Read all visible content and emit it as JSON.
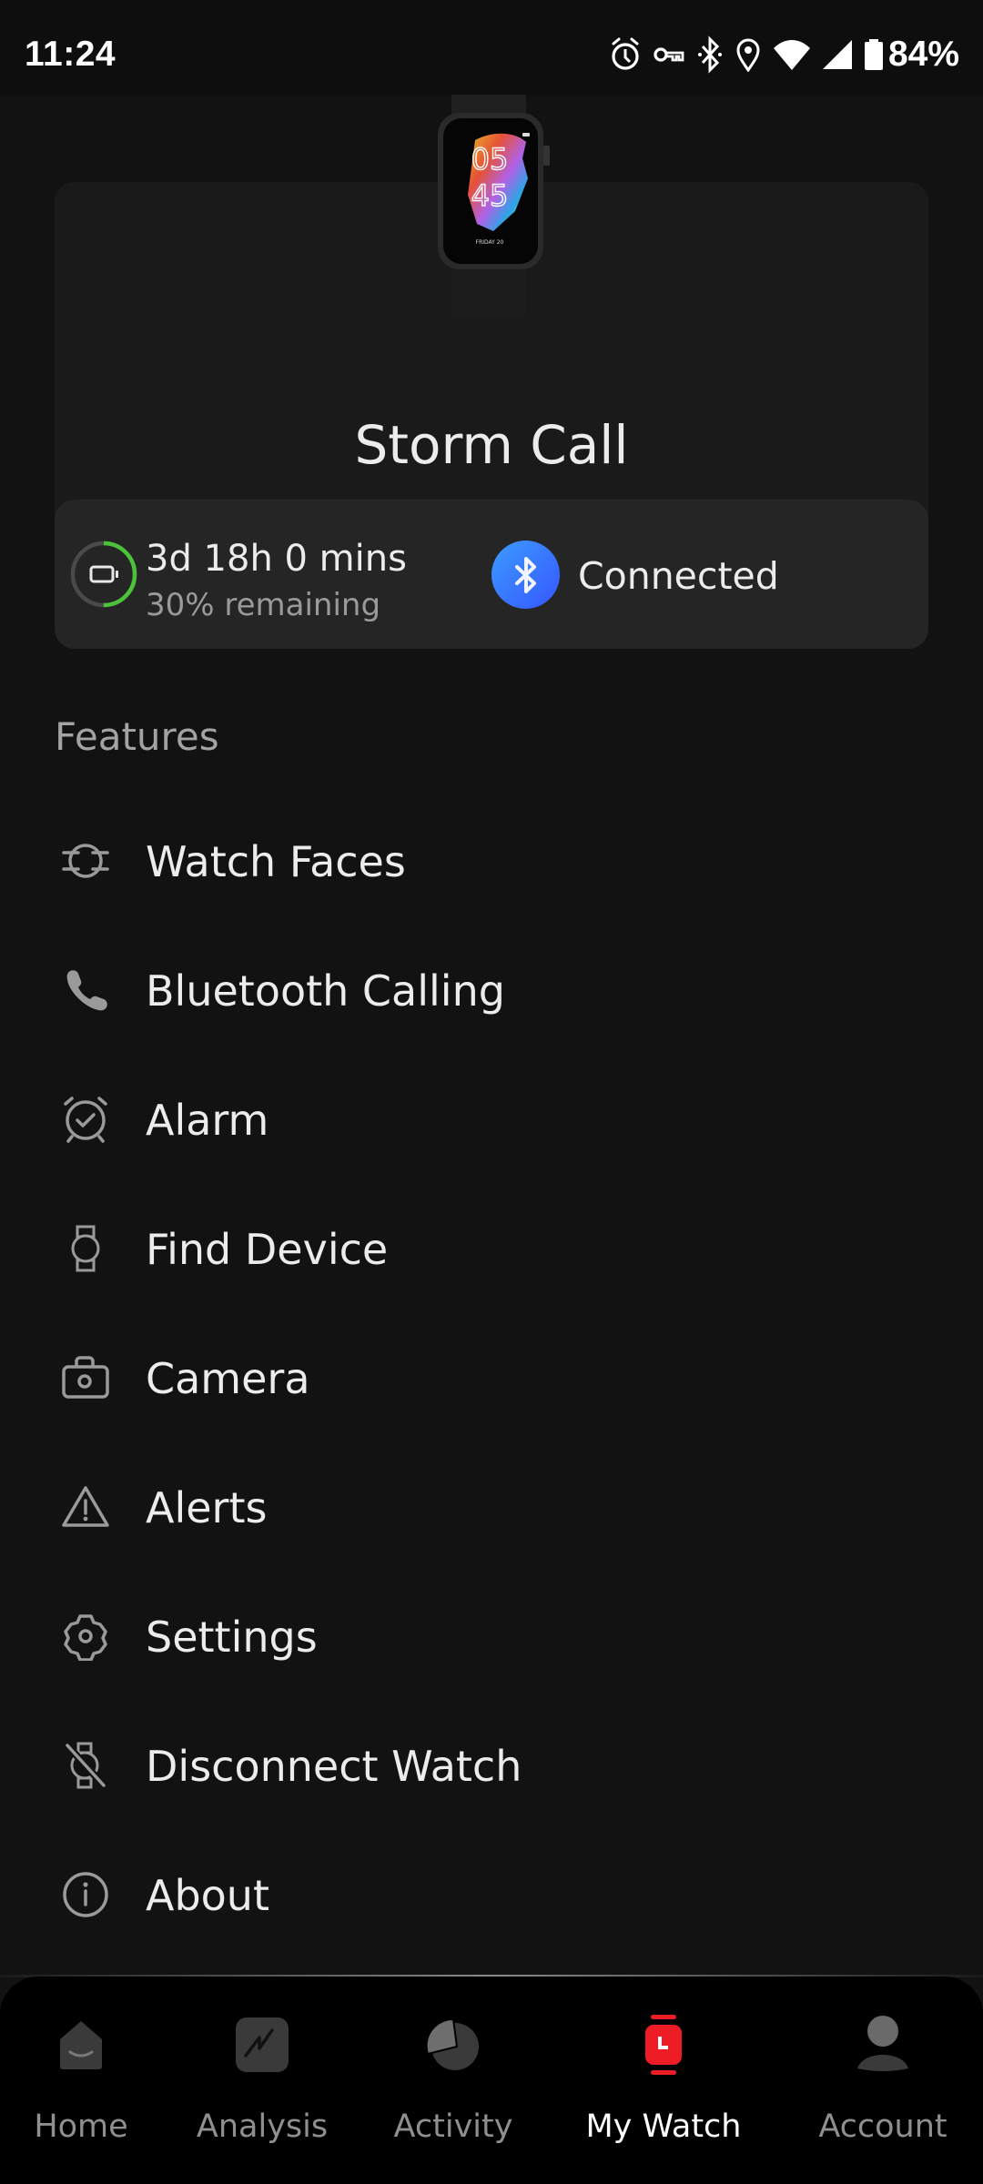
{
  "status_bar": {
    "time": "11:24",
    "icons": [
      "alarm-icon",
      "vpn-key-icon",
      "bluetooth-icon",
      "location-icon",
      "wifi-icon",
      "cell-signal-icon",
      "battery-icon"
    ],
    "battery_percent": "84%"
  },
  "device": {
    "name": "Storm Call",
    "image_alt": "Storm Call smartwatch",
    "watch_face": {
      "hour": "05",
      "minute": "45",
      "date": "FRIDAY 20"
    },
    "battery": {
      "time_left": "3d 18h 0 mins",
      "remaining_label": "30% remaining",
      "level": 0.3,
      "ring_color": "#4cc23a"
    },
    "connection": {
      "status": "Connected",
      "icon": "bluetooth-icon",
      "badge_color": "#3d7bff"
    }
  },
  "features": {
    "heading": "Features",
    "items": [
      {
        "label": "Watch Faces",
        "icon": "watch-face-icon"
      },
      {
        "label": "Bluetooth Calling",
        "icon": "phone-icon"
      },
      {
        "label": "Alarm",
        "icon": "alarm-clock-icon"
      },
      {
        "label": "Find Device",
        "icon": "watch-icon"
      },
      {
        "label": "Camera",
        "icon": "camera-icon"
      },
      {
        "label": "Alerts",
        "icon": "warning-icon"
      },
      {
        "label": "Settings",
        "icon": "gear-icon"
      },
      {
        "label": "Disconnect Watch",
        "icon": "watch-off-icon"
      },
      {
        "label": "About",
        "icon": "info-icon"
      }
    ]
  },
  "bottom_nav": {
    "active_color": "#ee1c25",
    "items": [
      {
        "label": "Home",
        "icon": "home-icon",
        "active": false
      },
      {
        "label": "Analysis",
        "icon": "analysis-icon",
        "active": false
      },
      {
        "label": "Activity",
        "icon": "activity-pie-icon",
        "active": false
      },
      {
        "label": "My Watch",
        "icon": "my-watch-icon",
        "active": true
      },
      {
        "label": "Account",
        "icon": "account-icon",
        "active": false
      }
    ]
  }
}
